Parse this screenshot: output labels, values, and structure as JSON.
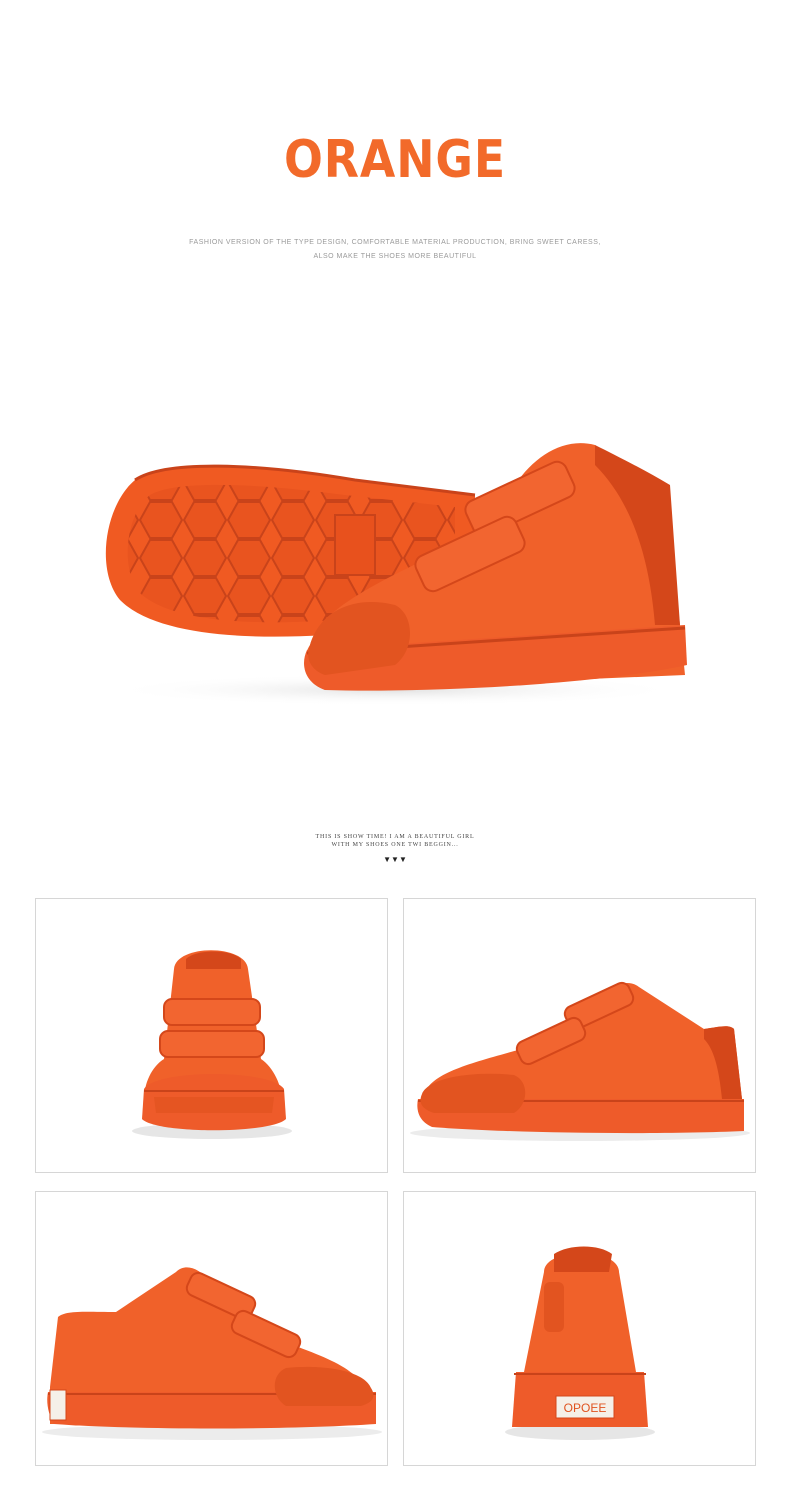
{
  "header": {
    "title": "ORANGE",
    "tagline_line1": "FASHION VERSION OF THE TYPE DESIGN, COMFORTABLE MATERIAL PRODUCTION, BRING SWEET CARESS,",
    "tagline_line2": "ALSO MAKE THE SHOES MORE BEAUTIFUL"
  },
  "caption": {
    "line1": "THIS IS SHOW TIME! I AM A BEAUTIFUL GIRL",
    "line2": "WITH MY SHOES ONE TWI BEGGIN...",
    "arrows": "▼▼▼"
  },
  "gallery": {
    "heel_label": "OPOEE",
    "views": [
      "front-view",
      "side-view-right",
      "side-view-left",
      "back-view"
    ]
  },
  "colors": {
    "accent": "#f26a2a",
    "shoe": "#f05a22",
    "shoe_dark": "#d4471a",
    "sole": "#ee5b2a"
  }
}
